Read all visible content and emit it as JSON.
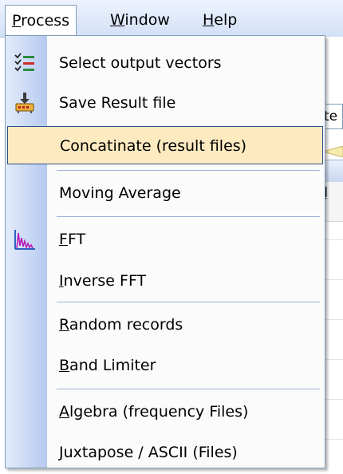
{
  "menubar": {
    "items": [
      {
        "label": "Process",
        "mnemonic": "P"
      },
      {
        "label": "Window",
        "mnemonic": "W"
      },
      {
        "label": "Help",
        "mnemonic": "H"
      }
    ]
  },
  "background": {
    "field_text": "te",
    "column_header_text": "ļ"
  },
  "menu": {
    "items": [
      {
        "label": "Select output vectors",
        "icon": "list-check-icon"
      },
      {
        "label": "Save Result file",
        "icon": "save-device-icon"
      },
      {
        "label": "Concatinate (result files)",
        "state": "highlighted"
      },
      {
        "label": "Moving Average"
      },
      {
        "label": "FFT",
        "icon": "spectrum-chart-icon",
        "mnemonic": "F"
      },
      {
        "label": "Inverse FFT",
        "mnemonic": "I"
      },
      {
        "label": "Random records",
        "mnemonic": "R"
      },
      {
        "label": "Band Limiter",
        "mnemonic": "B"
      },
      {
        "label": "Algebra (frequency Files)",
        "mnemonic": "A"
      },
      {
        "label": "Juxtapose / ASCII (Files)",
        "mnemonic": "J"
      }
    ]
  },
  "colors": {
    "highlight_bg": "#fdeac0",
    "highlight_border": "#2b4f8c",
    "gutter": "#c8d8f5",
    "menu_border": "#7f9db9"
  }
}
